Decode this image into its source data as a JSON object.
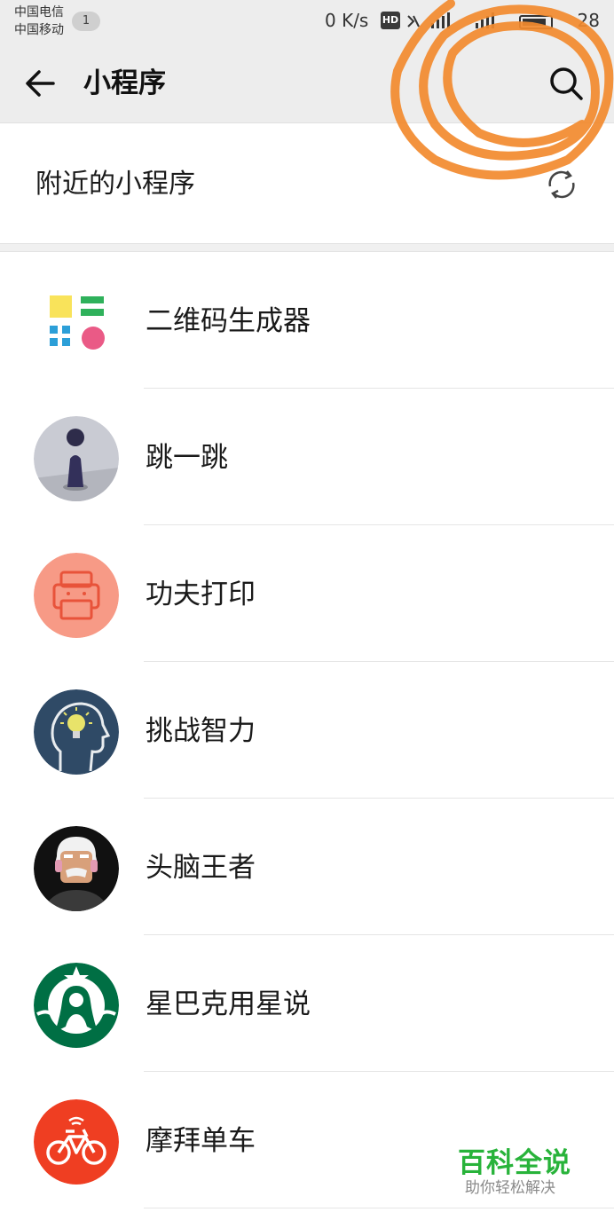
{
  "status_bar": {
    "carrier_1": "中国电信",
    "carrier_2": "中国移动",
    "sim_badge": "1",
    "net_speed": "0 K/s",
    "hd_label": "HD",
    "clock": "28"
  },
  "header": {
    "title": "小程序",
    "back_icon": "arrow-left-icon",
    "search_icon": "search-icon"
  },
  "nearby": {
    "label": "附近的小程序",
    "refresh_icon": "refresh-icon"
  },
  "apps": [
    {
      "name": "二维码生成器",
      "icon": "qr-generator-icon"
    },
    {
      "name": "跳一跳",
      "icon": "jump-game-icon"
    },
    {
      "name": "功夫打印",
      "icon": "printer-icon"
    },
    {
      "name": "挑战智力",
      "icon": "brain-bulb-icon"
    },
    {
      "name": "头脑王者",
      "icon": "old-man-icon"
    },
    {
      "name": "星巴克用星说",
      "icon": "starbucks-icon"
    },
    {
      "name": "摩拜单车",
      "icon": "bike-icon"
    }
  ],
  "watermark": {
    "title": "百科全说",
    "subtitle": "助你轻松解决"
  },
  "colors": {
    "header_bg": "#ededed",
    "annotation": "#f28a2e",
    "watermark_green": "#28b33a"
  }
}
